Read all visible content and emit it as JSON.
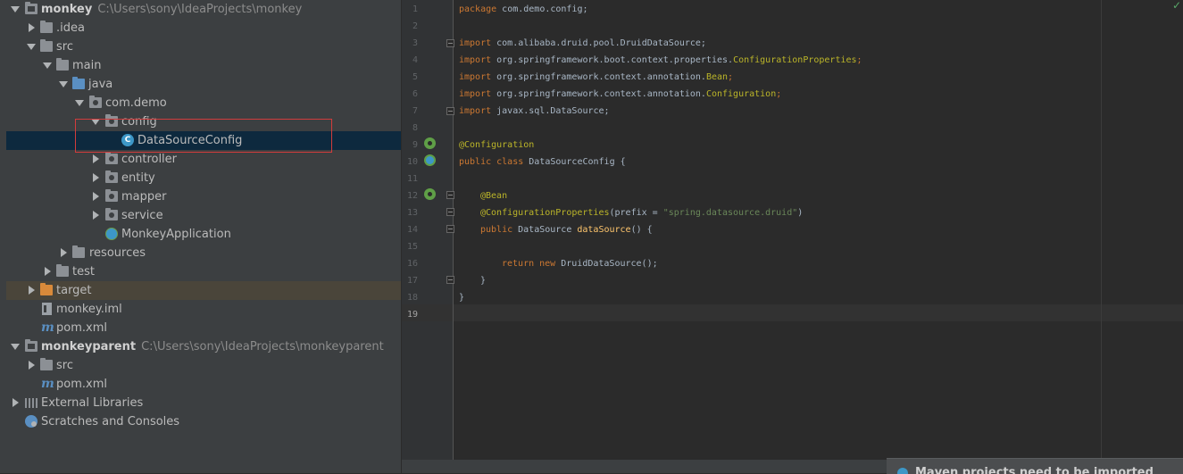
{
  "project_tree": {
    "rows": [
      {
        "label": "monkey",
        "path": "C:\\Users\\sony\\IdeaProjects\\monkey"
      },
      {
        "label": ".idea"
      },
      {
        "label": "src"
      },
      {
        "label": "main"
      },
      {
        "label": "java"
      },
      {
        "label": "com.demo"
      },
      {
        "label": "config"
      },
      {
        "label": "DataSourceConfig",
        "icon_text": "C"
      },
      {
        "label": "controller"
      },
      {
        "label": "entity"
      },
      {
        "label": "mapper"
      },
      {
        "label": "service"
      },
      {
        "label": "MonkeyApplication"
      },
      {
        "label": "resources"
      },
      {
        "label": "test"
      },
      {
        "label": "target"
      },
      {
        "label": "monkey.iml"
      },
      {
        "label": "pom.xml",
        "icon_text": "m"
      },
      {
        "label": "monkeyparent",
        "path": "C:\\Users\\sony\\IdeaProjects\\monkeyparent"
      },
      {
        "label": "src"
      },
      {
        "label": "pom.xml",
        "icon_text": "m"
      },
      {
        "label": "External Libraries"
      },
      {
        "label": "Scratches and Consoles"
      }
    ]
  },
  "editor": {
    "line_numbers": [
      "1",
      "2",
      "3",
      "4",
      "5",
      "6",
      "7",
      "8",
      "9",
      "10",
      "11",
      "12",
      "13",
      "14",
      "15",
      "16",
      "17",
      "18",
      "19"
    ],
    "code": {
      "l1_kw": "package",
      "l1_rest": " com.demo.config;",
      "l3_kw": "import",
      "l3_rest": " com.alibaba.druid.pool.DruidDataSource;",
      "l4_kw": "import",
      "l4_rest": " org.springframework.boot.context.properties.",
      "l4_ann": "ConfigurationProperties",
      "l4_end": ";",
      "l5_kw": "import",
      "l5_rest": " org.springframework.context.annotation.",
      "l5_ann": "Bean",
      "l5_end": ";",
      "l6_kw": "import",
      "l6_rest": " org.springframework.context.annotation.",
      "l6_ann": "Configuration",
      "l6_end": ";",
      "l7_kw": "import",
      "l7_rest": " javax.sql.DataSource;",
      "l9_ann": "@Configuration",
      "l10_kw": "public class",
      "l10_rest": " DataSourceConfig {",
      "l12_ann": "@Bean",
      "l13_ann": "@ConfigurationProperties",
      "l13_rest": "(prefix = ",
      "l13_str": "\"spring.datasource.druid\"",
      "l13_end": ")",
      "l14_kw": "public",
      "l14_rest": " DataSource ",
      "l14_fn": "dataSource",
      "l14_end": "() {",
      "l16_kw": "return new",
      "l16_rest": " DruidDataSource();",
      "l17": "}",
      "l18": "}"
    }
  },
  "notification": {
    "text": "Maven projects need to be imported"
  },
  "colors": {
    "keyword": "#cc7832",
    "annotation": "#bbb529",
    "string": "#6a8759",
    "method": "#ffc66d",
    "selection": "#0d293e",
    "highlight_box": "#d23c3c"
  },
  "icons": [
    "folder-icon",
    "class-icon",
    "maven-icon",
    "file-icon",
    "libraries-icon",
    "scratches-icon",
    "bean-gutter-icon"
  ]
}
